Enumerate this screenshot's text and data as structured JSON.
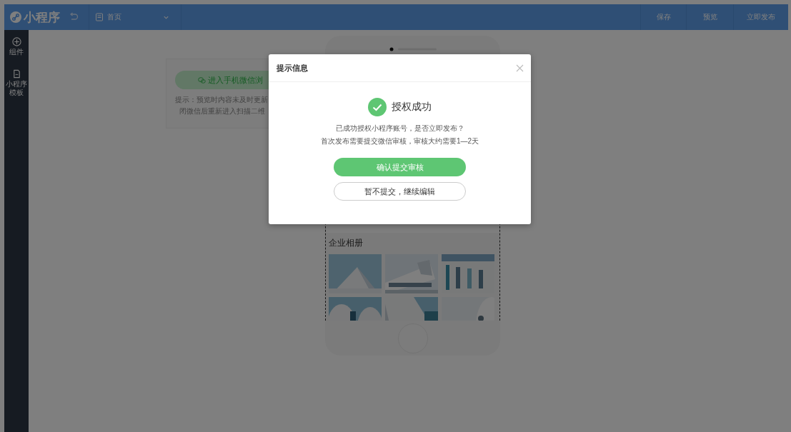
{
  "topbar": {
    "logo": "小程序",
    "page": {
      "label": "首页"
    },
    "actions": [
      "保存",
      "预览",
      "立即发布"
    ]
  },
  "sidebar": {
    "items": [
      {
        "label": "组件",
        "kind": "plus"
      },
      {
        "label": "小程序模板",
        "kind": "doc"
      }
    ]
  },
  "preview_card": {
    "button": "进入手机微信浏",
    "hint_lines": [
      "提示：预览时内容未及时更新",
      "闭微信后重新进入扫描二维"
    ]
  },
  "phone": {
    "album": {
      "title": "企业相册"
    }
  },
  "dialog": {
    "title": "提示信息",
    "status": "授权成功",
    "message_lines": [
      "已成功授权小程序账号，是否立即发布？",
      "首次发布需要提交微信审核，审核大约需要1—2天"
    ],
    "buttons": [
      {
        "label": "确认提交审核",
        "kind": "primary"
      },
      {
        "label": "暂不提交，继续编辑",
        "kind": "secondary"
      }
    ]
  }
}
